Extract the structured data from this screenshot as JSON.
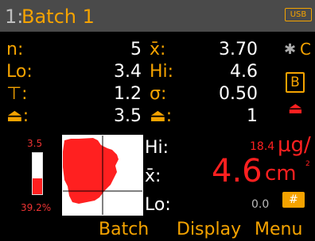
{
  "title": {
    "index": "1:",
    "name": "Batch 1"
  },
  "status": {
    "usb": "USB",
    "bluetooth_icon": "bluetooth-icon",
    "c_icon": "C",
    "b_label": "B"
  },
  "stats": {
    "n": {
      "label": "n:",
      "value": "5"
    },
    "mean": {
      "label": "x̄:",
      "value": "3.70"
    },
    "lo": {
      "label": "Lo:",
      "value": "3.4"
    },
    "hi": {
      "label": "Hi:",
      "value": "4.6"
    },
    "min": {
      "label": "⊤:",
      "value": "1.2"
    },
    "sigma": {
      "label": "σ:",
      "value": "0.50"
    },
    "max": {
      "label": "⏏:",
      "value": "3.5"
    },
    "count2": {
      "label": "⏏:",
      "value": "1"
    }
  },
  "gauge": {
    "top_value": "3.5",
    "percent": "39.2%",
    "fill_fraction": 0.392
  },
  "reading": {
    "hi_label": "Hi:",
    "mean_label": "x̄:",
    "lo_label": "Lo:",
    "hi_value": "18.4",
    "unit_top": "µg/",
    "value": "4.6",
    "unit_bottom": "cm",
    "unit_sup": "2",
    "lo_value": "0.0",
    "hash_button": "#"
  },
  "softkeys": {
    "left": "Batch",
    "middle": "Display",
    "right": "Menu"
  },
  "colors": {
    "accent": "#f5a300",
    "alarm": "#ff2020",
    "titlebar": "#4a4a4a"
  }
}
